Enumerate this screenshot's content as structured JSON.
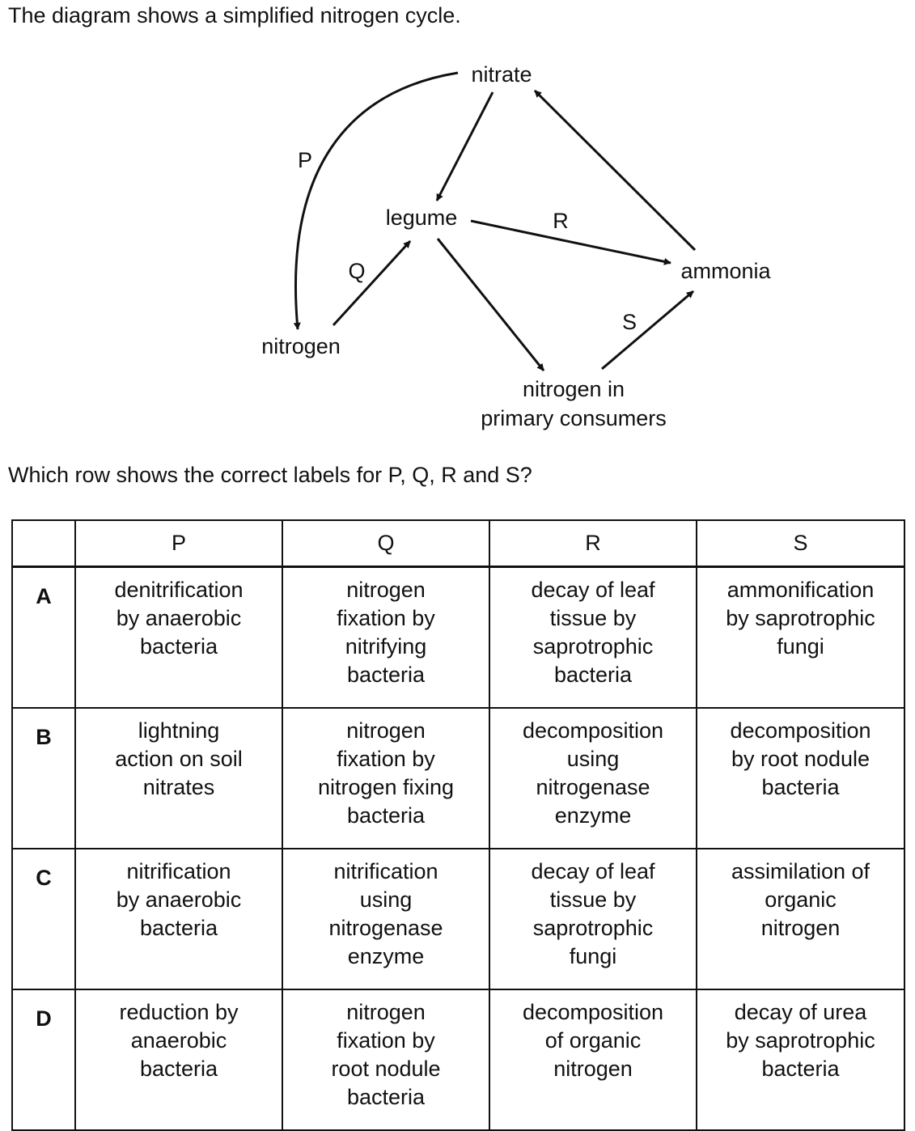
{
  "intro": "The diagram shows a simplified nitrogen cycle.",
  "diagram": {
    "nodes": {
      "nitrate": "nitrate",
      "legume": "legume",
      "ammonia": "ammonia",
      "nitrogen": "nitrogen",
      "consumers_line1": "nitrogen in",
      "consumers_line2": "primary consumers"
    },
    "labels": {
      "P": "P",
      "Q": "Q",
      "R": "R",
      "S": "S"
    }
  },
  "question": "Which row shows the correct labels for P, Q, R and S?",
  "table": {
    "headers": [
      "",
      "P",
      "Q",
      "R",
      "S"
    ],
    "rows": [
      {
        "letter": "A",
        "cells": [
          "denitrification\nby anaerobic\nbacteria",
          "nitrogen\nfixation by\nnitrifying\nbacteria",
          "decay of leaf\ntissue by\nsaprotrophic\nbacteria",
          "ammonification\nby saprotrophic\nfungi"
        ]
      },
      {
        "letter": "B",
        "cells": [
          "lightning\naction on soil\nnitrates",
          "nitrogen\nfixation by\nnitrogen fixing\nbacteria",
          "decomposition\nusing\nnitrogenase\nenzyme",
          "decomposition\nby root nodule\nbacteria"
        ]
      },
      {
        "letter": "C",
        "cells": [
          "nitrification\nby anaerobic\nbacteria",
          "nitrification\nusing\nnitrogenase\nenzyme",
          "decay of leaf\ntissue by\nsaprotrophic\nfungi",
          "assimilation of\norganic\nnitrogen"
        ]
      },
      {
        "letter": "D",
        "cells": [
          "reduction by\nanaerobic\nbacteria",
          "nitrogen\nfixation by\nroot nodule\nbacteria",
          "decomposition\nof organic\nnitrogen",
          "decay of urea\nby saprotrophic\nbacteria"
        ]
      }
    ]
  }
}
